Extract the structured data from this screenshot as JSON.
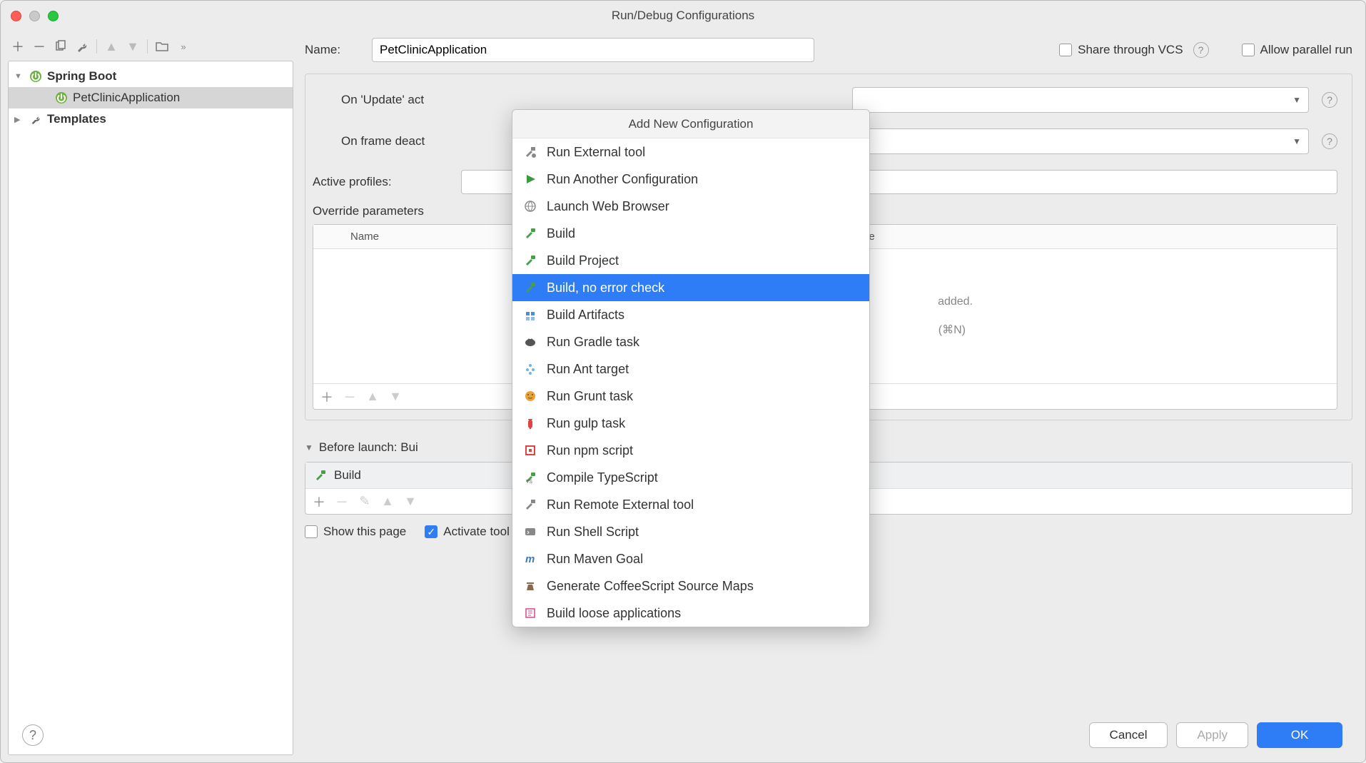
{
  "window": {
    "title": "Run/Debug Configurations"
  },
  "tree": {
    "root": {
      "label": "Spring Boot"
    },
    "child": {
      "label": "PetClinicApplication"
    },
    "templates": {
      "label": "Templates"
    }
  },
  "form": {
    "name_label": "Name:",
    "name_value": "PetClinicApplication",
    "share_label": "Share through VCS",
    "allow_parallel_label": "Allow parallel run",
    "on_update_label": "On 'Update' act",
    "on_frame_label": "On frame deact",
    "active_profiles_label": "Active profiles:",
    "override_params_label": "Override parameters",
    "table_name": "Name",
    "table_value": "Value",
    "table_empty1": "added.",
    "table_empty2": "(⌘N)",
    "before_launch_label": "Before launch: Bui",
    "build_item": "Build",
    "show_page_label": "Show this page",
    "activate_tool_label": "Activate tool window"
  },
  "popup": {
    "title": "Add New Configuration",
    "items": [
      "Run External tool",
      "Run Another Configuration",
      "Launch Web Browser",
      "Build",
      "Build Project",
      "Build, no error check",
      "Build Artifacts",
      "Run Gradle task",
      "Run Ant target",
      "Run Grunt task",
      "Run gulp task",
      "Run npm script",
      "Compile TypeScript",
      "Run Remote External tool",
      "Run Shell Script",
      "Run Maven Goal",
      "Generate CoffeeScript Source Maps",
      "Build loose applications"
    ],
    "selected_index": 5
  },
  "footer": {
    "cancel": "Cancel",
    "apply": "Apply",
    "ok": "OK"
  }
}
